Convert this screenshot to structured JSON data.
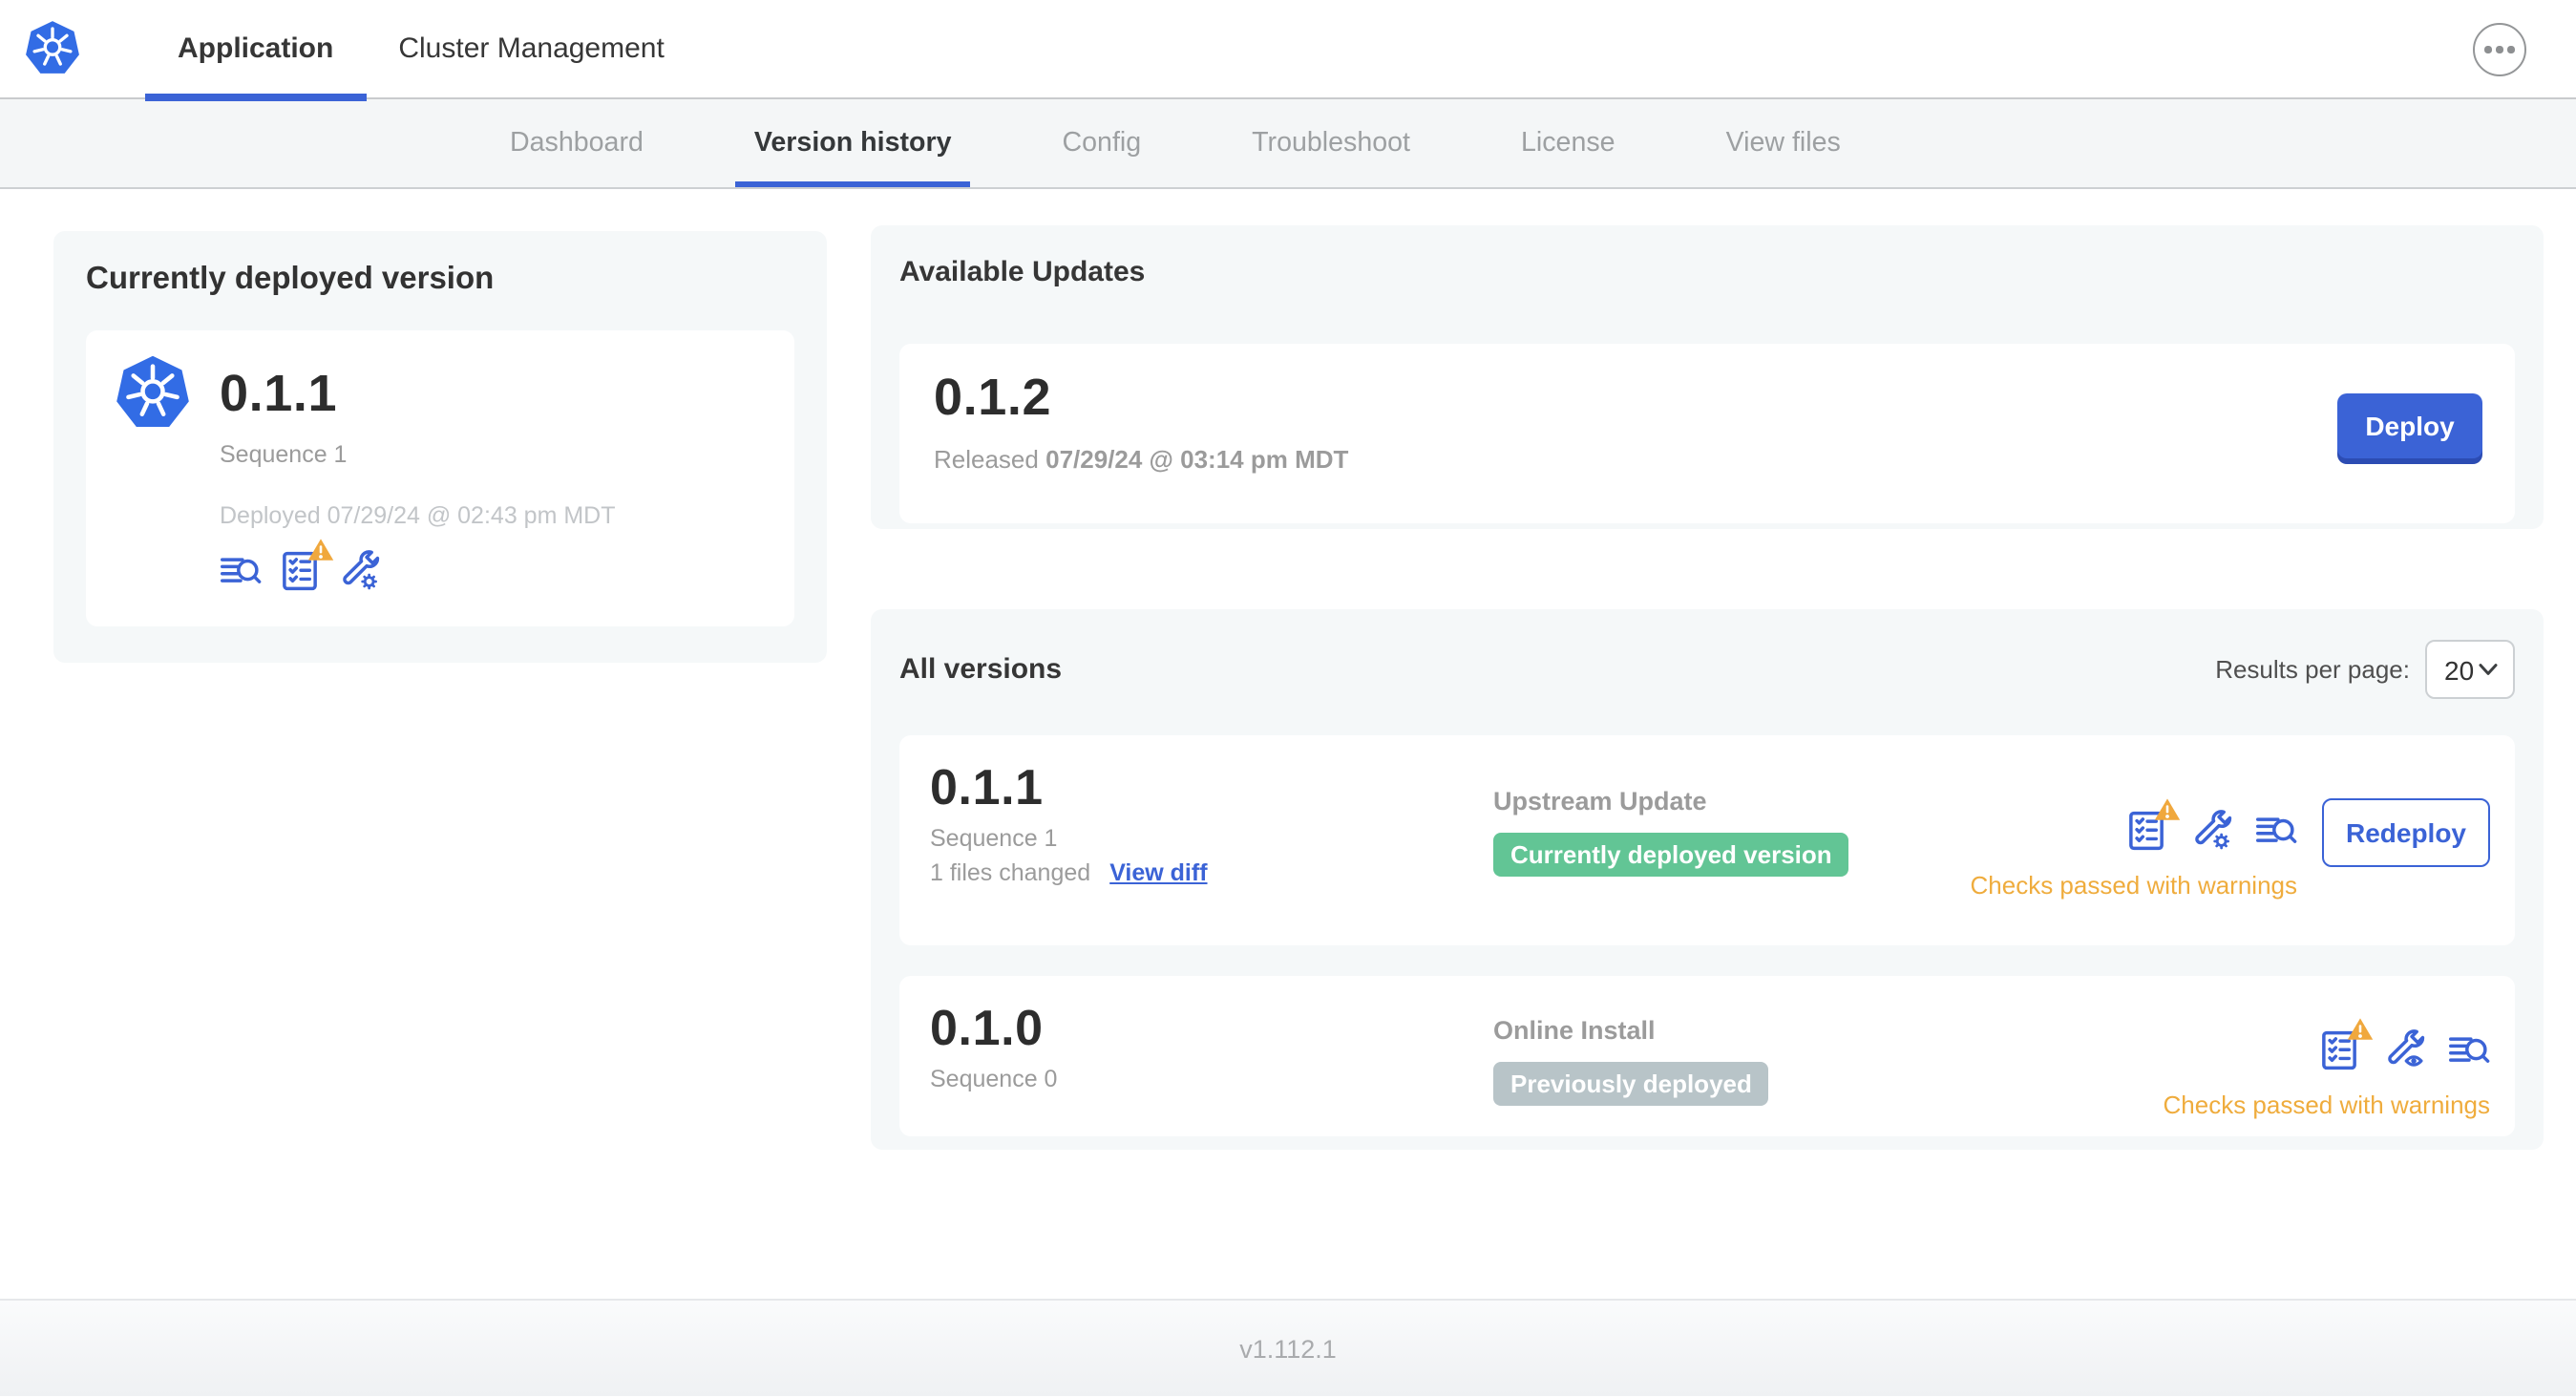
{
  "header": {
    "tabs": [
      {
        "label": "Application",
        "active": true
      },
      {
        "label": "Cluster Management",
        "active": false
      }
    ],
    "more_menu_icon": "ellipsis-circle-icon",
    "logo_icon": "kubernetes-icon"
  },
  "subnav": {
    "items": [
      {
        "label": "Dashboard",
        "active": false
      },
      {
        "label": "Version history",
        "active": true
      },
      {
        "label": "Config",
        "active": false
      },
      {
        "label": "Troubleshoot",
        "active": false
      },
      {
        "label": "License",
        "active": false
      },
      {
        "label": "View files",
        "active": false
      }
    ]
  },
  "current_version_card": {
    "title": "Currently deployed version",
    "version": "0.1.1",
    "sequence": "Sequence 1",
    "deployed_at": "Deployed 07/29/24 @ 02:43 pm MDT",
    "icons": [
      "logs-icon",
      "preflight-checks-icon-with-warning",
      "config-wrench-gear-icon"
    ]
  },
  "available_updates": {
    "title": "Available Updates",
    "version": "0.1.2",
    "released_prefix": "Released",
    "released_at": "07/29/24 @ 03:14 pm MDT",
    "deploy_label": "Deploy"
  },
  "all_versions": {
    "title": "All versions",
    "results_per_page_label": "Results per page:",
    "results_per_page_value": "20",
    "rows": [
      {
        "version": "0.1.1",
        "sequence": "Sequence 1",
        "files_changed": "1 files changed",
        "view_diff_label": "View diff",
        "source": "Upstream Update",
        "badge": "Currently deployed version",
        "badge_color": "#62C595",
        "status": "Checks passed with warnings",
        "action_label": "Redeploy",
        "icons": [
          "preflight-checks-icon-with-warning",
          "config-wrench-gear-icon",
          "logs-icon"
        ]
      },
      {
        "version": "0.1.0",
        "sequence": "Sequence 0",
        "source": "Online Install",
        "badge": "Previously deployed",
        "badge_color": "#B8C4C8",
        "status": "Checks passed with warnings",
        "icons": [
          "preflight-checks-icon-with-warning",
          "config-wrench-eye-icon",
          "logs-icon"
        ]
      }
    ]
  },
  "footer": {
    "version": "v1.112.1"
  },
  "colors": {
    "accent_blue": "#3B63D6",
    "kubernetes_blue": "#326CE5",
    "warning_amber": "#EFAC3D",
    "badge_green": "#62C595",
    "badge_gray": "#B8C4C8"
  }
}
